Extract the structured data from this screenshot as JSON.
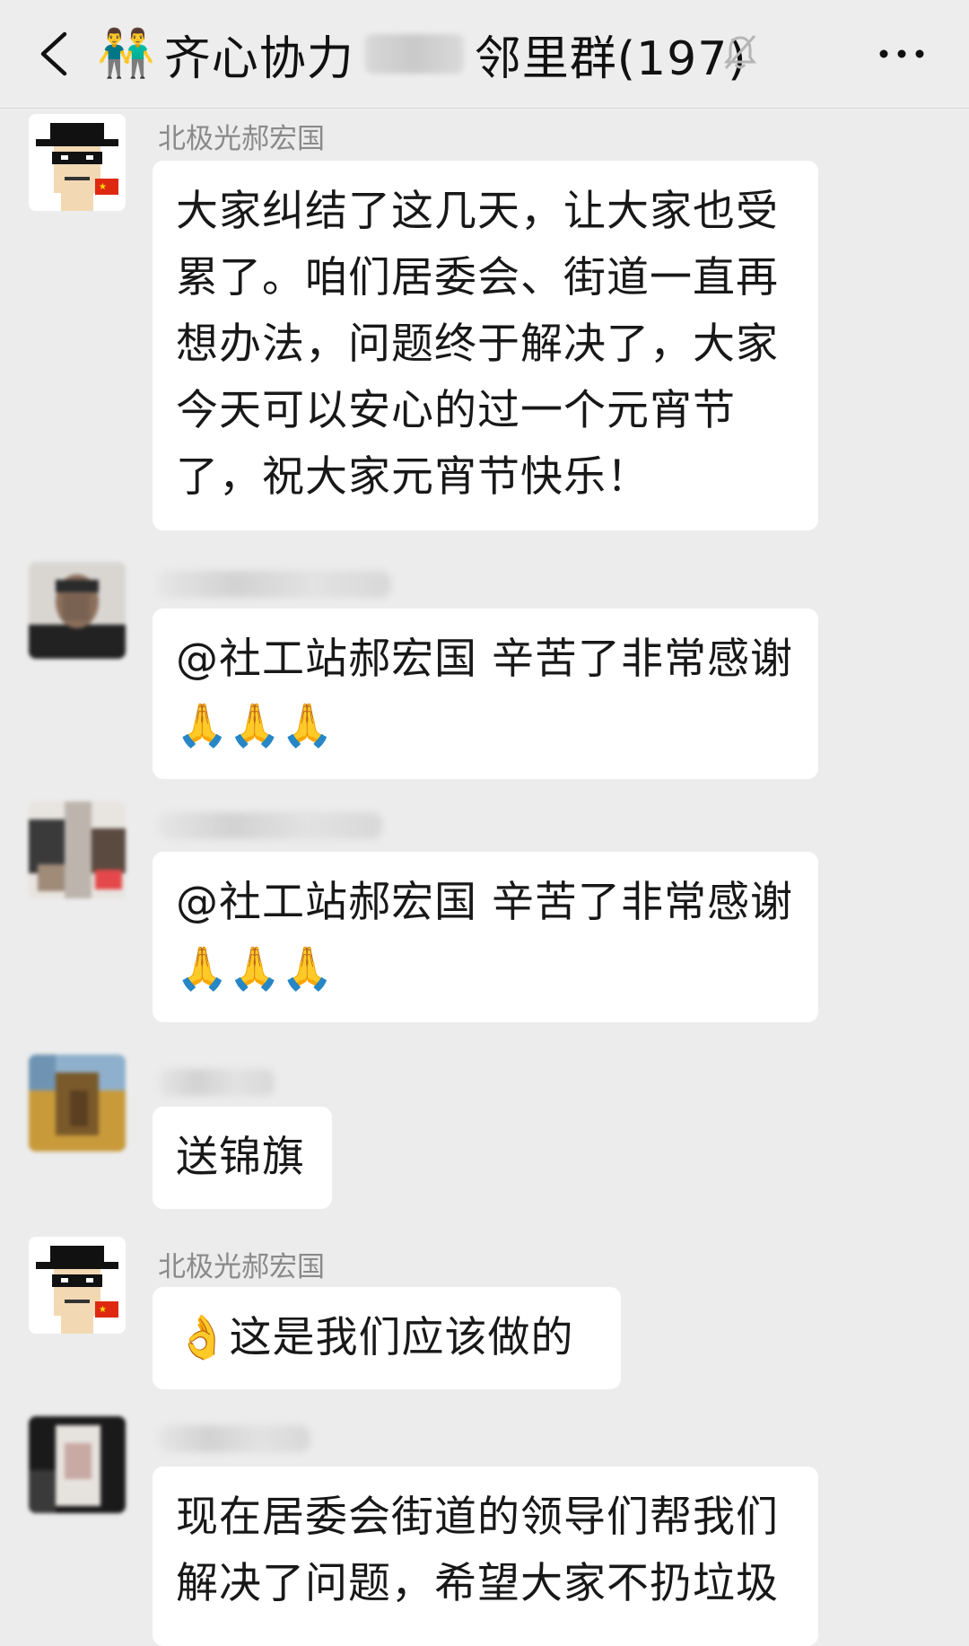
{
  "header": {
    "group_emoji": "👬",
    "title_prefix": "齐心协力",
    "title_suffix": "邻里群(197)",
    "icons": [
      "back-arrow-icon",
      "mute-bell-icon",
      "more-icon"
    ]
  },
  "messages": [
    {
      "sender": "北极光郝宏国",
      "text": "大家纠结了这几天，让大家也受累了。咱们居委会、街道一直再想办法，问题终于解决了，大家今天可以安心的过一个元宵节了，祝大家元宵节快乐！"
    },
    {
      "sender": "",
      "text": "@社工站郝宏国  辛苦了非常感谢",
      "emoji": "🙏🙏🙏"
    },
    {
      "sender": "",
      "text": "@社工站郝宏国  辛苦了非常感谢",
      "emoji": "🙏🙏🙏"
    },
    {
      "sender": "",
      "text": "送锦旗"
    },
    {
      "sender": "北极光郝宏国",
      "emoji": "👌",
      "text": "这是我们应该做的"
    },
    {
      "sender": "",
      "text": "现在居委会街道的领导们帮我们解决了问题，希望大家不扔垃圾"
    }
  ]
}
